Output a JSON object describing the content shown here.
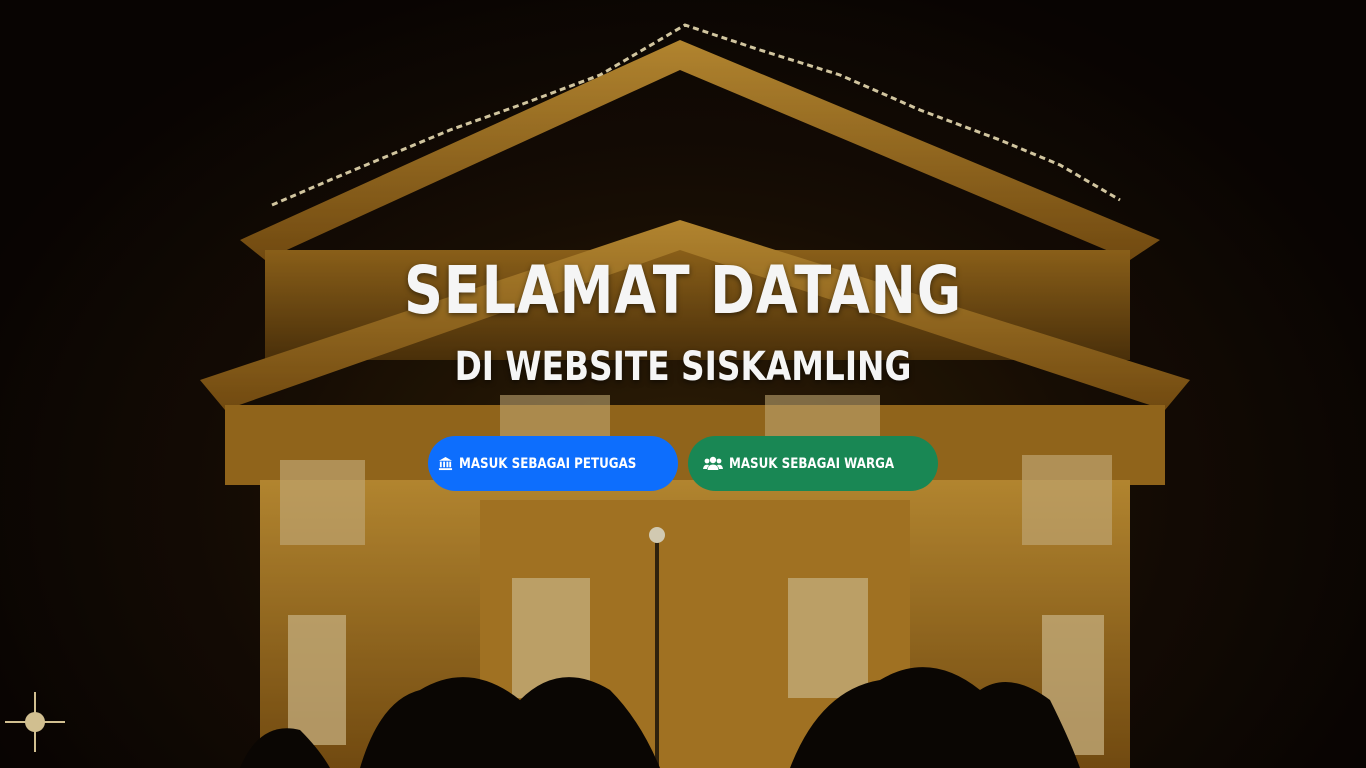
{
  "hero": {
    "title": "SELAMAT DATANG",
    "subtitle": "DI WEBSITE SISKAMLING"
  },
  "buttons": {
    "petugas": {
      "label": "MASUK SEBAGAI PETUGAS",
      "icon": "building-columns-icon",
      "color": "#0d6efd"
    },
    "warga": {
      "label": "MASUK SEBAGAI WARGA",
      "icon": "users-icon",
      "color": "#198754"
    }
  },
  "background": {
    "description_icon": "illuminated-monument-photo",
    "accent": "#e0a030"
  }
}
